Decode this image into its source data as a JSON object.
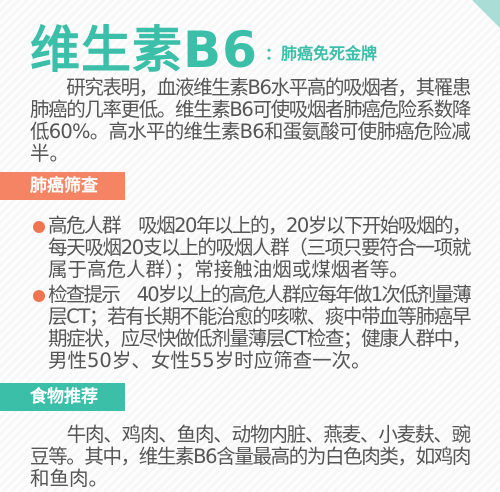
{
  "title": "维生素B6",
  "subtitle": "：肺癌免死金牌",
  "intro": [
    "　　研究表明，血液维生素B6水平高的吸烟者，其罹患",
    "肺癌的几率更低。维生素B6可使吸烟者肺癌危险系数降",
    "低60%。高水平的维生素B6和蛋氨酸可使肺癌危险减",
    "半。"
  ],
  "screening": {
    "heading": "肺癌筛查",
    "items": [
      {
        "lines": [
          "高危人群　吸烟20年以上的，20岁以下开始吸烟的，",
          "每天吸烟20支以上的吸烟人群（三项只要符合一项就",
          "属于高危人群）；常接触油烟或煤烟者等。"
        ]
      },
      {
        "lines": [
          "检查提示　40岁以上的高危人群应每年做1次低剂量薄",
          "层CT；若有长期不能治愈的咳嗽、痰中带血等肺癌早",
          "期症状，应尽快做低剂量薄层CT检查；健康人群中，",
          "男性50岁、女性55岁时应筛查一次。"
        ]
      }
    ]
  },
  "food": {
    "heading": "食物推荐",
    "lines": [
      "　　牛肉、鸡肉、鱼肉、动物内脏、燕麦、小麦麸、豌",
      "豆等。其中，维生素B6含量最高的为白色肉类，如鸡肉",
      "和鱼肉。"
    ]
  }
}
